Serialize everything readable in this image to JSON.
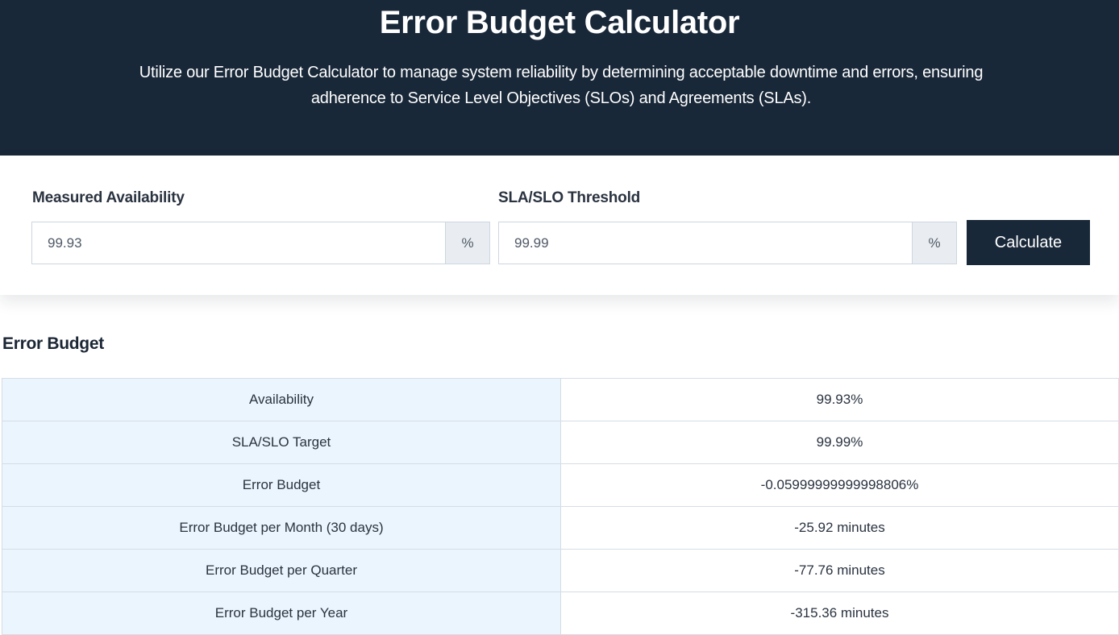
{
  "hero": {
    "title": "Error Budget Calculator",
    "description": "Utilize our Error Budget Calculator to manage system reliability by determining acceptable downtime and errors, ensuring adherence to Service Level Objectives (SLOs) and Agreements (SLAs)."
  },
  "form": {
    "availability": {
      "label": "Measured Availability",
      "value": "99.93",
      "unit": "%"
    },
    "threshold": {
      "label": "SLA/SLO Threshold",
      "value": "99.99",
      "unit": "%"
    },
    "calculate_label": "Calculate"
  },
  "results": {
    "title": "Error Budget",
    "rows": [
      {
        "label": "Availability",
        "value": "99.93%"
      },
      {
        "label": "SLA/SLO Target",
        "value": "99.99%"
      },
      {
        "label": "Error Budget",
        "value": "-0.05999999999998806%"
      },
      {
        "label": "Error Budget per Month (30 days)",
        "value": "-25.92 minutes"
      },
      {
        "label": "Error Budget per Quarter",
        "value": "-77.76 minutes"
      },
      {
        "label": "Error Budget per Year",
        "value": "-315.36 minutes"
      }
    ]
  },
  "colors": {
    "header_bg": "#192839",
    "button_bg": "#192839",
    "table_key_bg": "#ebf5fd",
    "addon_bg": "#e9edf1"
  }
}
